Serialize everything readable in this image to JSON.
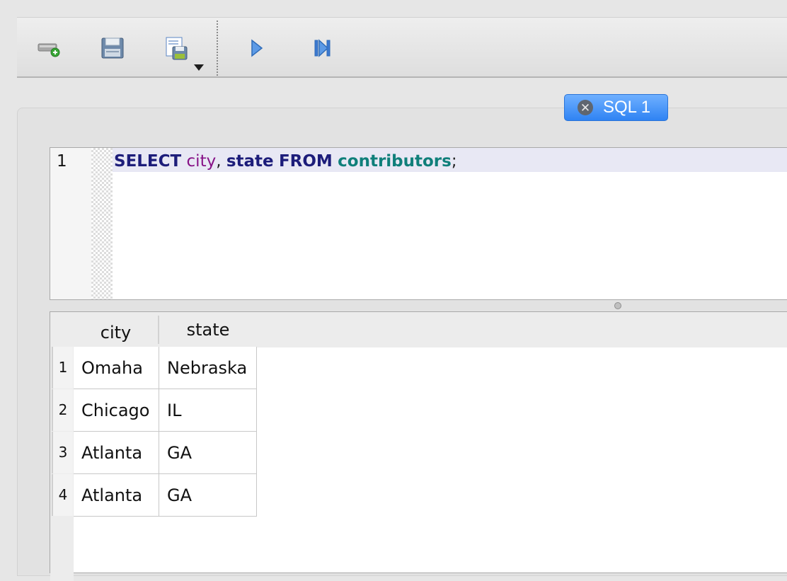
{
  "toolbar": {
    "buttons": [
      {
        "name": "new-connection",
        "icon": "add-connection-icon"
      },
      {
        "name": "save",
        "icon": "save-icon"
      },
      {
        "name": "save-as",
        "icon": "save-as-icon",
        "has_dropdown": true
      },
      {
        "name": "execute",
        "icon": "play-icon"
      },
      {
        "name": "execute-all",
        "icon": "play-to-end-icon"
      }
    ]
  },
  "tab": {
    "label": "SQL 1",
    "close_glyph": "✕",
    "color": "#2f83f3"
  },
  "editor": {
    "line_number": "1",
    "tokens": {
      "t1": "SELECT",
      "t2": " ",
      "t3": "city",
      "t4": ", ",
      "t5": "state",
      "t6": " ",
      "t7": "FROM",
      "t8": " ",
      "t9": "contributors",
      "t10": ";"
    },
    "colors": {
      "keyword": "#1d1d7a",
      "identifier": "#871287",
      "table": "#0f7f7a"
    }
  },
  "results": {
    "columns": [
      "city",
      "state"
    ],
    "rows": [
      {
        "num": "1",
        "city": "Omaha",
        "state": "Nebraska"
      },
      {
        "num": "2",
        "city": "Chicago",
        "state": "IL"
      },
      {
        "num": "3",
        "city": "Atlanta",
        "state": "GA"
      },
      {
        "num": "4",
        "city": "Atlanta",
        "state": "GA"
      }
    ]
  }
}
